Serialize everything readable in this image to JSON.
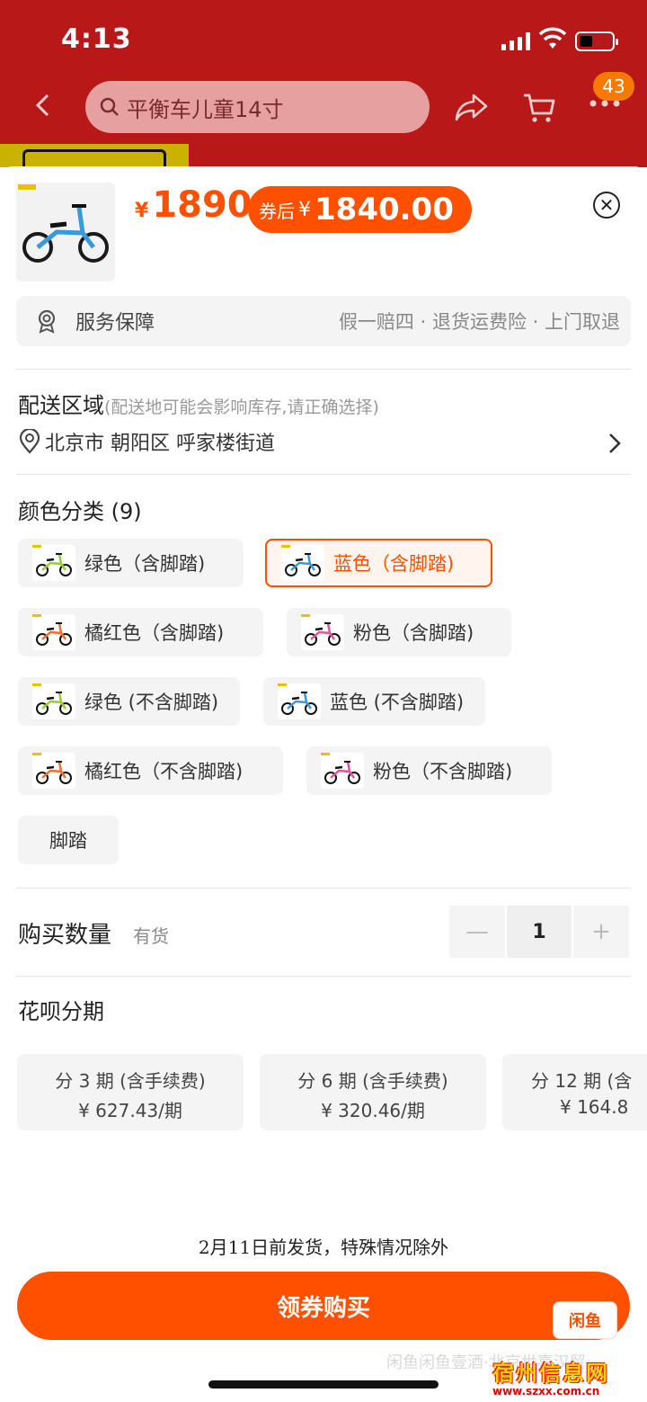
{
  "status": {
    "time": "4:13"
  },
  "nav": {
    "search_text": "平衡车儿童14寸",
    "cart_badge": "43"
  },
  "product": {
    "price_yen": "¥",
    "price": "1890",
    "coupon_label": "券后",
    "coupon_yen": "¥",
    "coupon_price": "1840.00"
  },
  "service": {
    "title": "服务保障",
    "detail": "假一赔四 · 退货运费险 · 上门取退"
  },
  "delivery": {
    "title": "配送区域",
    "hint": "(配送地可能会影响库存,请正确选择)",
    "address": "北京市 朝阳区 呼家楼街道"
  },
  "colors": {
    "title": "颜色分类 (9)",
    "options": [
      {
        "label": "绿色（含脚踏)",
        "color": "#9acd32",
        "selected": false
      },
      {
        "label": "蓝色（含脚踏)",
        "color": "#3a9ad9",
        "selected": true
      },
      {
        "label": "橘红色（含脚踏)",
        "color": "#f07030",
        "selected": false
      },
      {
        "label": "粉色（含脚踏)",
        "color": "#e0559a",
        "selected": false
      },
      {
        "label": "绿色 (不含脚踏)",
        "color": "#9acd32",
        "selected": false
      },
      {
        "label": "蓝色 (不含脚踏)",
        "color": "#3a9ad9",
        "selected": false
      },
      {
        "label": "橘红色（不含脚踏)",
        "color": "#f07030",
        "selected": false
      },
      {
        "label": "粉色（不含脚踏)",
        "color": "#e0559a",
        "selected": false
      },
      {
        "label": "脚踏",
        "color": "",
        "selected": false
      }
    ]
  },
  "quantity": {
    "label": "购买数量",
    "stock": "有货",
    "minus": "—",
    "value": "1",
    "plus": "+"
  },
  "huabei": {
    "title": "花呗分期",
    "plans": [
      {
        "line1": "分 3 期 (含手续费)",
        "line2": "¥ 627.43/期"
      },
      {
        "line1": "分 6 期 (含手续费)",
        "line2": "¥ 320.46/期"
      },
      {
        "line1": "分 12 期 (含",
        "line2": "¥ 164.8"
      }
    ]
  },
  "footer": {
    "ship_note": "2月11日前发货，特殊情况除外",
    "buy_label": "领券购买",
    "xianyu_label": "闲鱼",
    "watermark": "闲鱼闲鱼壹酒·北京世嘉汉贸"
  },
  "site_watermark": {
    "line1": "宿州信息网",
    "line2": "www.szxx.com.cn"
  }
}
